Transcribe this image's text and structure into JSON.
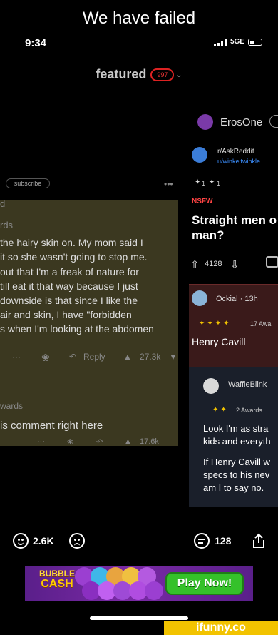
{
  "meme": {
    "caption": "We have failed"
  },
  "status_bar": {
    "time": "9:34",
    "network": "5GE"
  },
  "feed_header": {
    "label": "featured",
    "count": "997"
  },
  "left_comment": {
    "subscribe_label": "subscribe",
    "more_label": "•••",
    "partial_meta_1": "d",
    "partial_meta_2": "rds",
    "lines": [
      " the hairy skin on. My mom said I",
      "it so she wasn't going to stop me.",
      "out that I'm a freak of nature for",
      "till eat it that way because I just",
      " downside is that since I like the",
      "air and skin, I have \"forbidden",
      "s when I'm looking at the  abdomen"
    ],
    "reply_label": "Reply",
    "upvotes": "27.3k",
    "awards_label": "wards",
    "second_comment": "is comment right here",
    "second_upvotes": "17.6k"
  },
  "right_post": {
    "poster": "ErosOne",
    "subreddit": "r/AskReddit",
    "user": "u/winkeltwinkle",
    "award_1": "1",
    "award_2": "1",
    "nsfw": "NSFW",
    "title_1": "Straight men o",
    "title_2": "man?",
    "votes": "4128",
    "commenter_1": "Ockial · 13h",
    "comment_1_awards": "17 Awa",
    "comment_1_text": "Henry Cavill",
    "commenter_2": "WaffleBlink",
    "comment_2_awards": "2 Awards",
    "comment_2_lines": [
      "Look I'm as stra",
      "kids and everyth",
      "",
      "If Henry Cavill w",
      "specs to his nev",
      "am I to say no."
    ]
  },
  "toolbar": {
    "smiles": "2.6K",
    "comments": "128"
  },
  "ad": {
    "logo_top": "BUBBLE",
    "logo_bottom": "CASH",
    "cta": "Play Now!"
  },
  "watermark": "ifunny.co",
  "colors": {
    "featured_badge": "#dd2222",
    "nsfw": "#ff4444",
    "ad_button": "#35c12a",
    "watermark_bg": "#f2c300"
  }
}
